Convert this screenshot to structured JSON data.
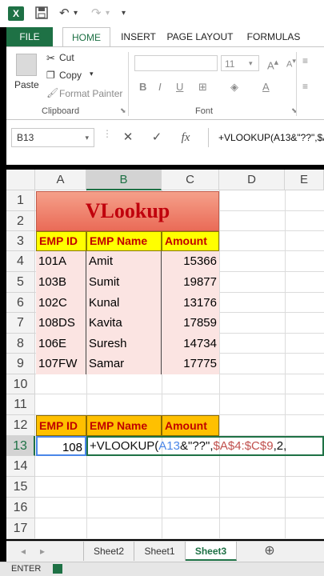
{
  "titlebar": {
    "logo": "X"
  },
  "ribbon_tabs": [
    "FILE",
    "HOME",
    "INSERT",
    "PAGE LAYOUT",
    "FORMULAS"
  ],
  "clipboard": {
    "cut": "Cut",
    "copy": "Copy",
    "paste": "Paste",
    "format_painter": "Format Painter",
    "label": "Clipboard"
  },
  "font": {
    "size": "11",
    "label": "Font",
    "bold": "B",
    "italic": "I",
    "underline": "U"
  },
  "formula_bar": {
    "name_box": "B13",
    "cancel": "✕",
    "enter": "✓",
    "fx": "fx",
    "formula": "+VLOOKUP(A13&\"??\",$A"
  },
  "columns": [
    "A",
    "B",
    "C",
    "D",
    "E"
  ],
  "rows": [
    "1",
    "2",
    "3",
    "4",
    "5",
    "6",
    "7",
    "8",
    "9",
    "10",
    "11",
    "12",
    "13",
    "14",
    "15",
    "16",
    "17"
  ],
  "sheet": {
    "title": "VLookup",
    "headers": [
      "EMP ID",
      "EMP Name",
      "Amount"
    ],
    "data": [
      [
        "101A",
        "Amit",
        "15366"
      ],
      [
        "103B",
        "Sumit",
        "19877"
      ],
      [
        "102C",
        "Kunal",
        "13176"
      ],
      [
        "108DS",
        "Kavita",
        "17859"
      ],
      [
        "106E",
        "Suresh",
        "14734"
      ],
      [
        "107FW",
        "Samar",
        "17775"
      ]
    ],
    "headers2": [
      "EMP ID",
      "EMP Name",
      "Amount"
    ],
    "a13": "108",
    "formula_parts": [
      "+VLOOKUP(",
      "A13",
      "&\"??\",",
      "$A$4:$C$9",
      ",2,"
    ]
  },
  "sheet_tabs": [
    "Sheet2",
    "Sheet1",
    "Sheet3"
  ],
  "status": {
    "mode": "ENTER"
  },
  "colors": {
    "excel_green": "#1e7145",
    "title_red": "#c0000c",
    "header_yellow": "#ffff00",
    "header_orange": "#ffc000"
  }
}
